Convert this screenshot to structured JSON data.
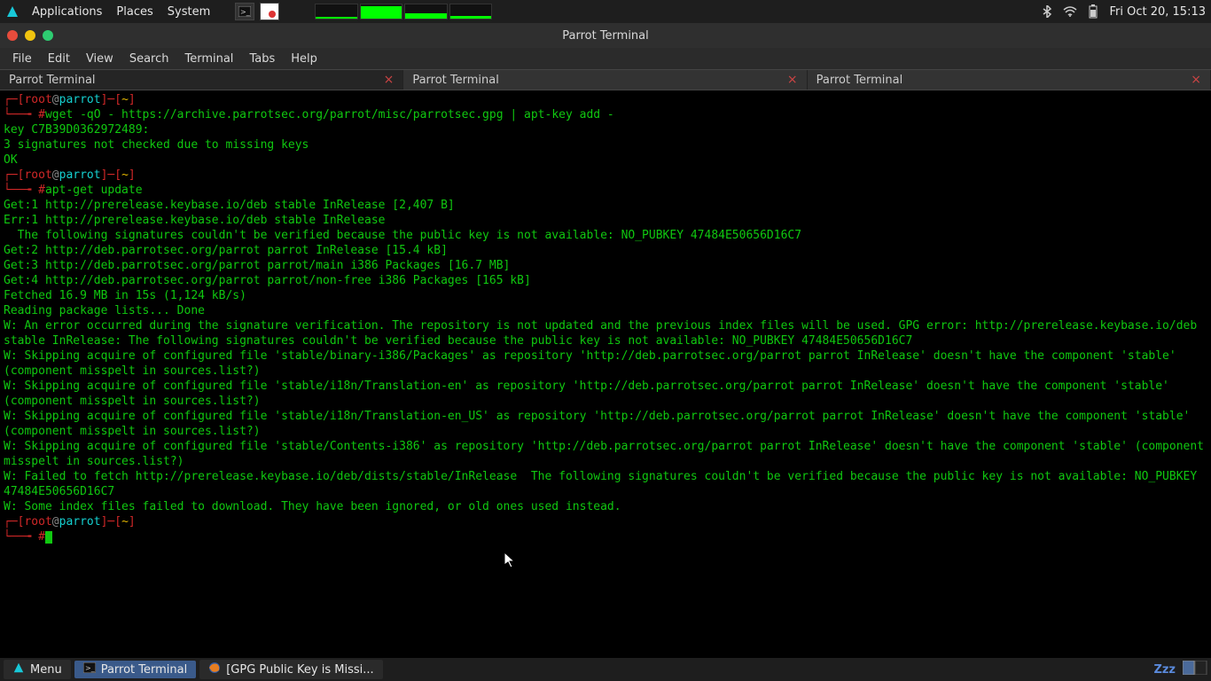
{
  "top": {
    "applications": "Applications",
    "places": "Places",
    "system": "System",
    "clock": "Fri Oct 20, 15:13"
  },
  "window": {
    "title": "Parrot Terminal",
    "menus": [
      "File",
      "Edit",
      "View",
      "Search",
      "Terminal",
      "Tabs",
      "Help"
    ],
    "tabs": [
      "Parrot Terminal",
      "Parrot Terminal",
      "Parrot Terminal"
    ]
  },
  "prompt": {
    "lbracket": "┌─[",
    "user": "root",
    "at": "@",
    "host": "parrot",
    "rbracket": "]─[",
    "cwd": "~",
    "end": "]",
    "line2_arrow": "└──╼ ",
    "hash": "#"
  },
  "term": {
    "cmd1": "wget -qO - https://archive.parrotsec.org/parrot/misc/parrotsec.gpg | apt-key add -",
    "out1a": "key C7B39D0362972489:",
    "out1b": "3 signatures not checked due to missing keys",
    "out1c": "OK",
    "cmd2": "apt-get update",
    "get1": "Get:1 http://prerelease.keybase.io/deb stable InRelease [2,407 B]",
    "err1": "Err:1 http://prerelease.keybase.io/deb stable InRelease",
    "err1b": "  The following signatures couldn't be verified because the public key is not available: NO_PUBKEY 47484E50656D16C7",
    "get2": "Get:2 http://deb.parrotsec.org/parrot parrot InRelease [15.4 kB]",
    "get3": "Get:3 http://deb.parrotsec.org/parrot parrot/main i386 Packages [16.7 MB]",
    "get4": "Get:4 http://deb.parrotsec.org/parrot parrot/non-free i386 Packages [165 kB]",
    "fetched": "Fetched 16.9 MB in 15s (1,124 kB/s)",
    "reading": "Reading package lists... Done",
    "w1": "W: An error occurred during the signature verification. The repository is not updated and the previous index files will be used. GPG error: http://prerelease.keybase.io/deb stable InRelease: The following signatures couldn't be verified because the public key is not available: NO_PUBKEY 47484E50656D16C7",
    "w2": "W: Skipping acquire of configured file 'stable/binary-i386/Packages' as repository 'http://deb.parrotsec.org/parrot parrot InRelease' doesn't have the component 'stable' (component misspelt in sources.list?)",
    "w3": "W: Skipping acquire of configured file 'stable/i18n/Translation-en' as repository 'http://deb.parrotsec.org/parrot parrot InRelease' doesn't have the component 'stable' (component misspelt in sources.list?)",
    "w4": "W: Skipping acquire of configured file 'stable/i18n/Translation-en_US' as repository 'http://deb.parrotsec.org/parrot parrot InRelease' doesn't have the component 'stable' (component misspelt in sources.list?)",
    "w5": "W: Skipping acquire of configured file 'stable/Contents-i386' as repository 'http://deb.parrotsec.org/parrot parrot InRelease' doesn't have the component 'stable' (component misspelt in sources.list?)",
    "w6": "W: Failed to fetch http://prerelease.keybase.io/deb/dists/stable/InRelease  The following signatures couldn't be verified because the public key is not available: NO_PUBKEY 47484E50656D16C7",
    "w7": "W: Some index files failed to download. They have been ignored, or old ones used instead."
  },
  "bottom": {
    "menu": "Menu",
    "task1": "Parrot Terminal",
    "task2": "[GPG Public Key is Missi...",
    "zzz": "Zzz"
  }
}
